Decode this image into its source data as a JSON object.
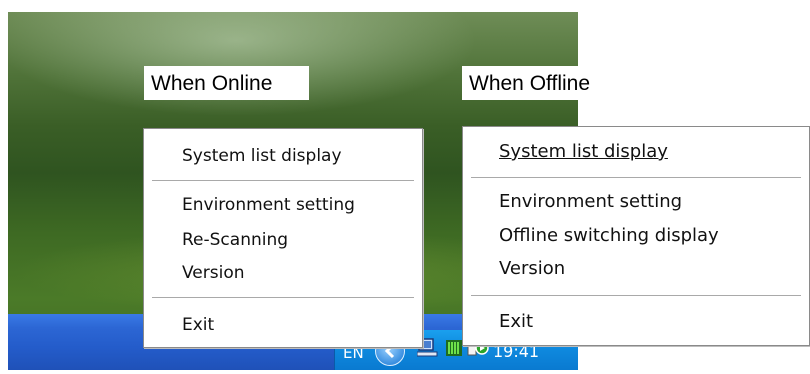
{
  "captions": {
    "online": "When Online",
    "offline": "When Offline"
  },
  "online_menu": {
    "items": [
      "System list display",
      "Environment setting",
      "Re-Scanning",
      "Version",
      "Exit"
    ]
  },
  "offline_menu": {
    "items": [
      "System list display",
      "Environment setting",
      "Offline switching display",
      "Version",
      "Exit"
    ]
  },
  "tray": {
    "language": "EN",
    "clock": "19:41",
    "icons": [
      "chevron-left-icon",
      "network-computer-icon",
      "green-bars-icon",
      "speaker-icon"
    ]
  }
}
